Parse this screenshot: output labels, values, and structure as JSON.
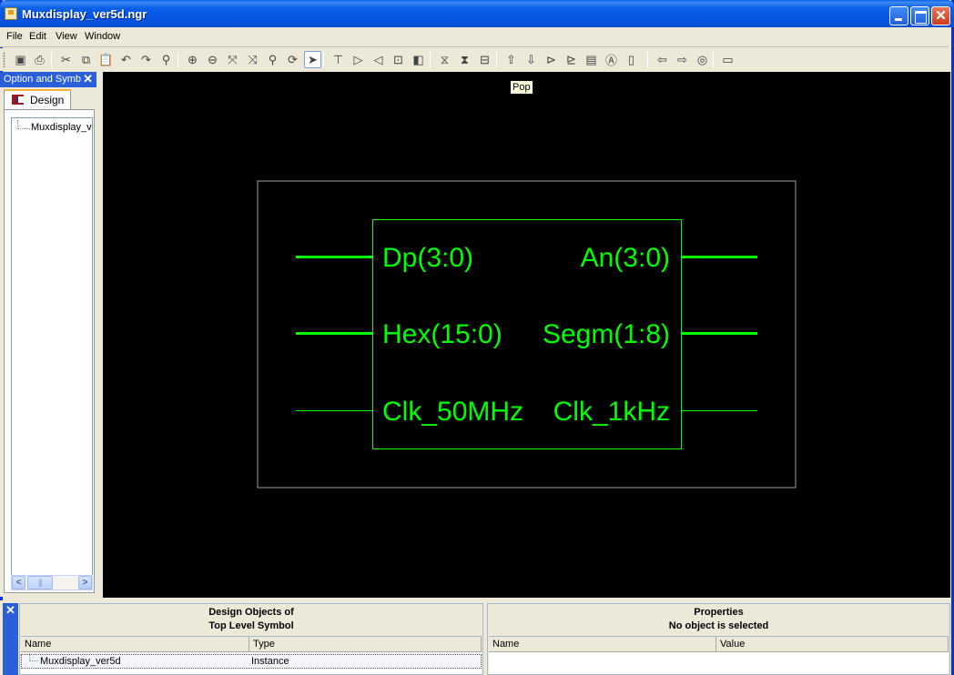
{
  "window": {
    "title": "Muxdisplay_ver5d.ngr"
  },
  "menu": [
    "File",
    "Edit",
    "View",
    "Window"
  ],
  "toolbar": {
    "buttons": [
      {
        "icon": "save-icon",
        "glyph": "▣"
      },
      {
        "icon": "print-icon",
        "glyph": "⎙"
      },
      {
        "icon": "cut-icon",
        "glyph": "✂"
      },
      {
        "icon": "copy-icon",
        "glyph": "⧉"
      },
      {
        "icon": "paste-icon",
        "glyph": "📋"
      },
      {
        "icon": "undo-icon",
        "glyph": "↶"
      },
      {
        "icon": "redo-icon",
        "glyph": "↷"
      },
      {
        "icon": "find-icon",
        "glyph": "⚲"
      },
      {
        "icon": "zoom-in-icon",
        "glyph": "⊕"
      },
      {
        "icon": "zoom-out-icon",
        "glyph": "⊖"
      },
      {
        "icon": "zoom-full-view-icon",
        "glyph": "⤧"
      },
      {
        "icon": "zoom-to-box-icon",
        "glyph": "⤨"
      },
      {
        "icon": "zoom-selected-icon",
        "glyph": "⚲"
      },
      {
        "icon": "refresh-icon",
        "glyph": "⟳"
      },
      {
        "icon": "select-pointer-icon",
        "glyph": "➤"
      },
      {
        "icon": "add-pin-icon",
        "glyph": "⊤"
      },
      {
        "icon": "add-input-icon",
        "glyph": "▷"
      },
      {
        "icon": "add-output-icon",
        "glyph": "◁"
      },
      {
        "icon": "hide-pins-icon",
        "glyph": "⊡"
      },
      {
        "icon": "show-pins-icon",
        "glyph": "◧"
      },
      {
        "icon": "rtl-view-icon",
        "glyph": "⧖"
      },
      {
        "icon": "rtl-sch-icon",
        "glyph": "⧗"
      },
      {
        "icon": "hierarchy-icon",
        "glyph": "⊟"
      },
      {
        "icon": "push-up-icon",
        "glyph": "⇧"
      },
      {
        "icon": "push-down-icon",
        "glyph": "⇩"
      },
      {
        "icon": "expand-block-icon",
        "glyph": "⊳"
      },
      {
        "icon": "expand-input-icon",
        "glyph": "⊵"
      },
      {
        "icon": "properties-icon",
        "glyph": "▤"
      },
      {
        "icon": "text-label-icon",
        "glyph": "Ⓐ"
      },
      {
        "icon": "box-icon",
        "glyph": "▯"
      },
      {
        "icon": "back-icon",
        "glyph": "⇦"
      },
      {
        "icon": "forward-icon",
        "glyph": "⇨"
      },
      {
        "icon": "web-update-icon",
        "glyph": "◎"
      },
      {
        "icon": "window-icon",
        "glyph": "▭"
      }
    ],
    "active_tool": "select-pointer-icon"
  },
  "left_panel": {
    "title": "Option and Symb",
    "tab": "Design",
    "tree_items": [
      "Muxdisplay_v"
    ]
  },
  "canvas": {
    "tooltip": "Pop",
    "colors": {
      "background": "#000000",
      "symbol": "#00ff00",
      "frame": "#a0a0a0"
    },
    "symbol": {
      "inputs": [
        {
          "name": "Dp(3:0)",
          "bus": true
        },
        {
          "name": "Hex(15:0)",
          "bus": true
        },
        {
          "name": "Clk_50MHz",
          "bus": false
        }
      ],
      "outputs": [
        {
          "name": "An(3:0)",
          "bus": true
        },
        {
          "name": "Segm(1:8)",
          "bus": true
        },
        {
          "name": "Clk_1kHz",
          "bus": false
        }
      ]
    }
  },
  "design_objects": {
    "title_line1": "Design Objects of",
    "title_line2": "Top Level Symbol",
    "columns": [
      "Name",
      "Type"
    ],
    "rows": [
      {
        "name": "Muxdisplay_ver5d",
        "type": "Instance"
      }
    ]
  },
  "properties": {
    "title_line1": "Properties",
    "title_line2": "No object is selected",
    "columns": [
      "Name",
      "Value"
    ],
    "rows": []
  }
}
